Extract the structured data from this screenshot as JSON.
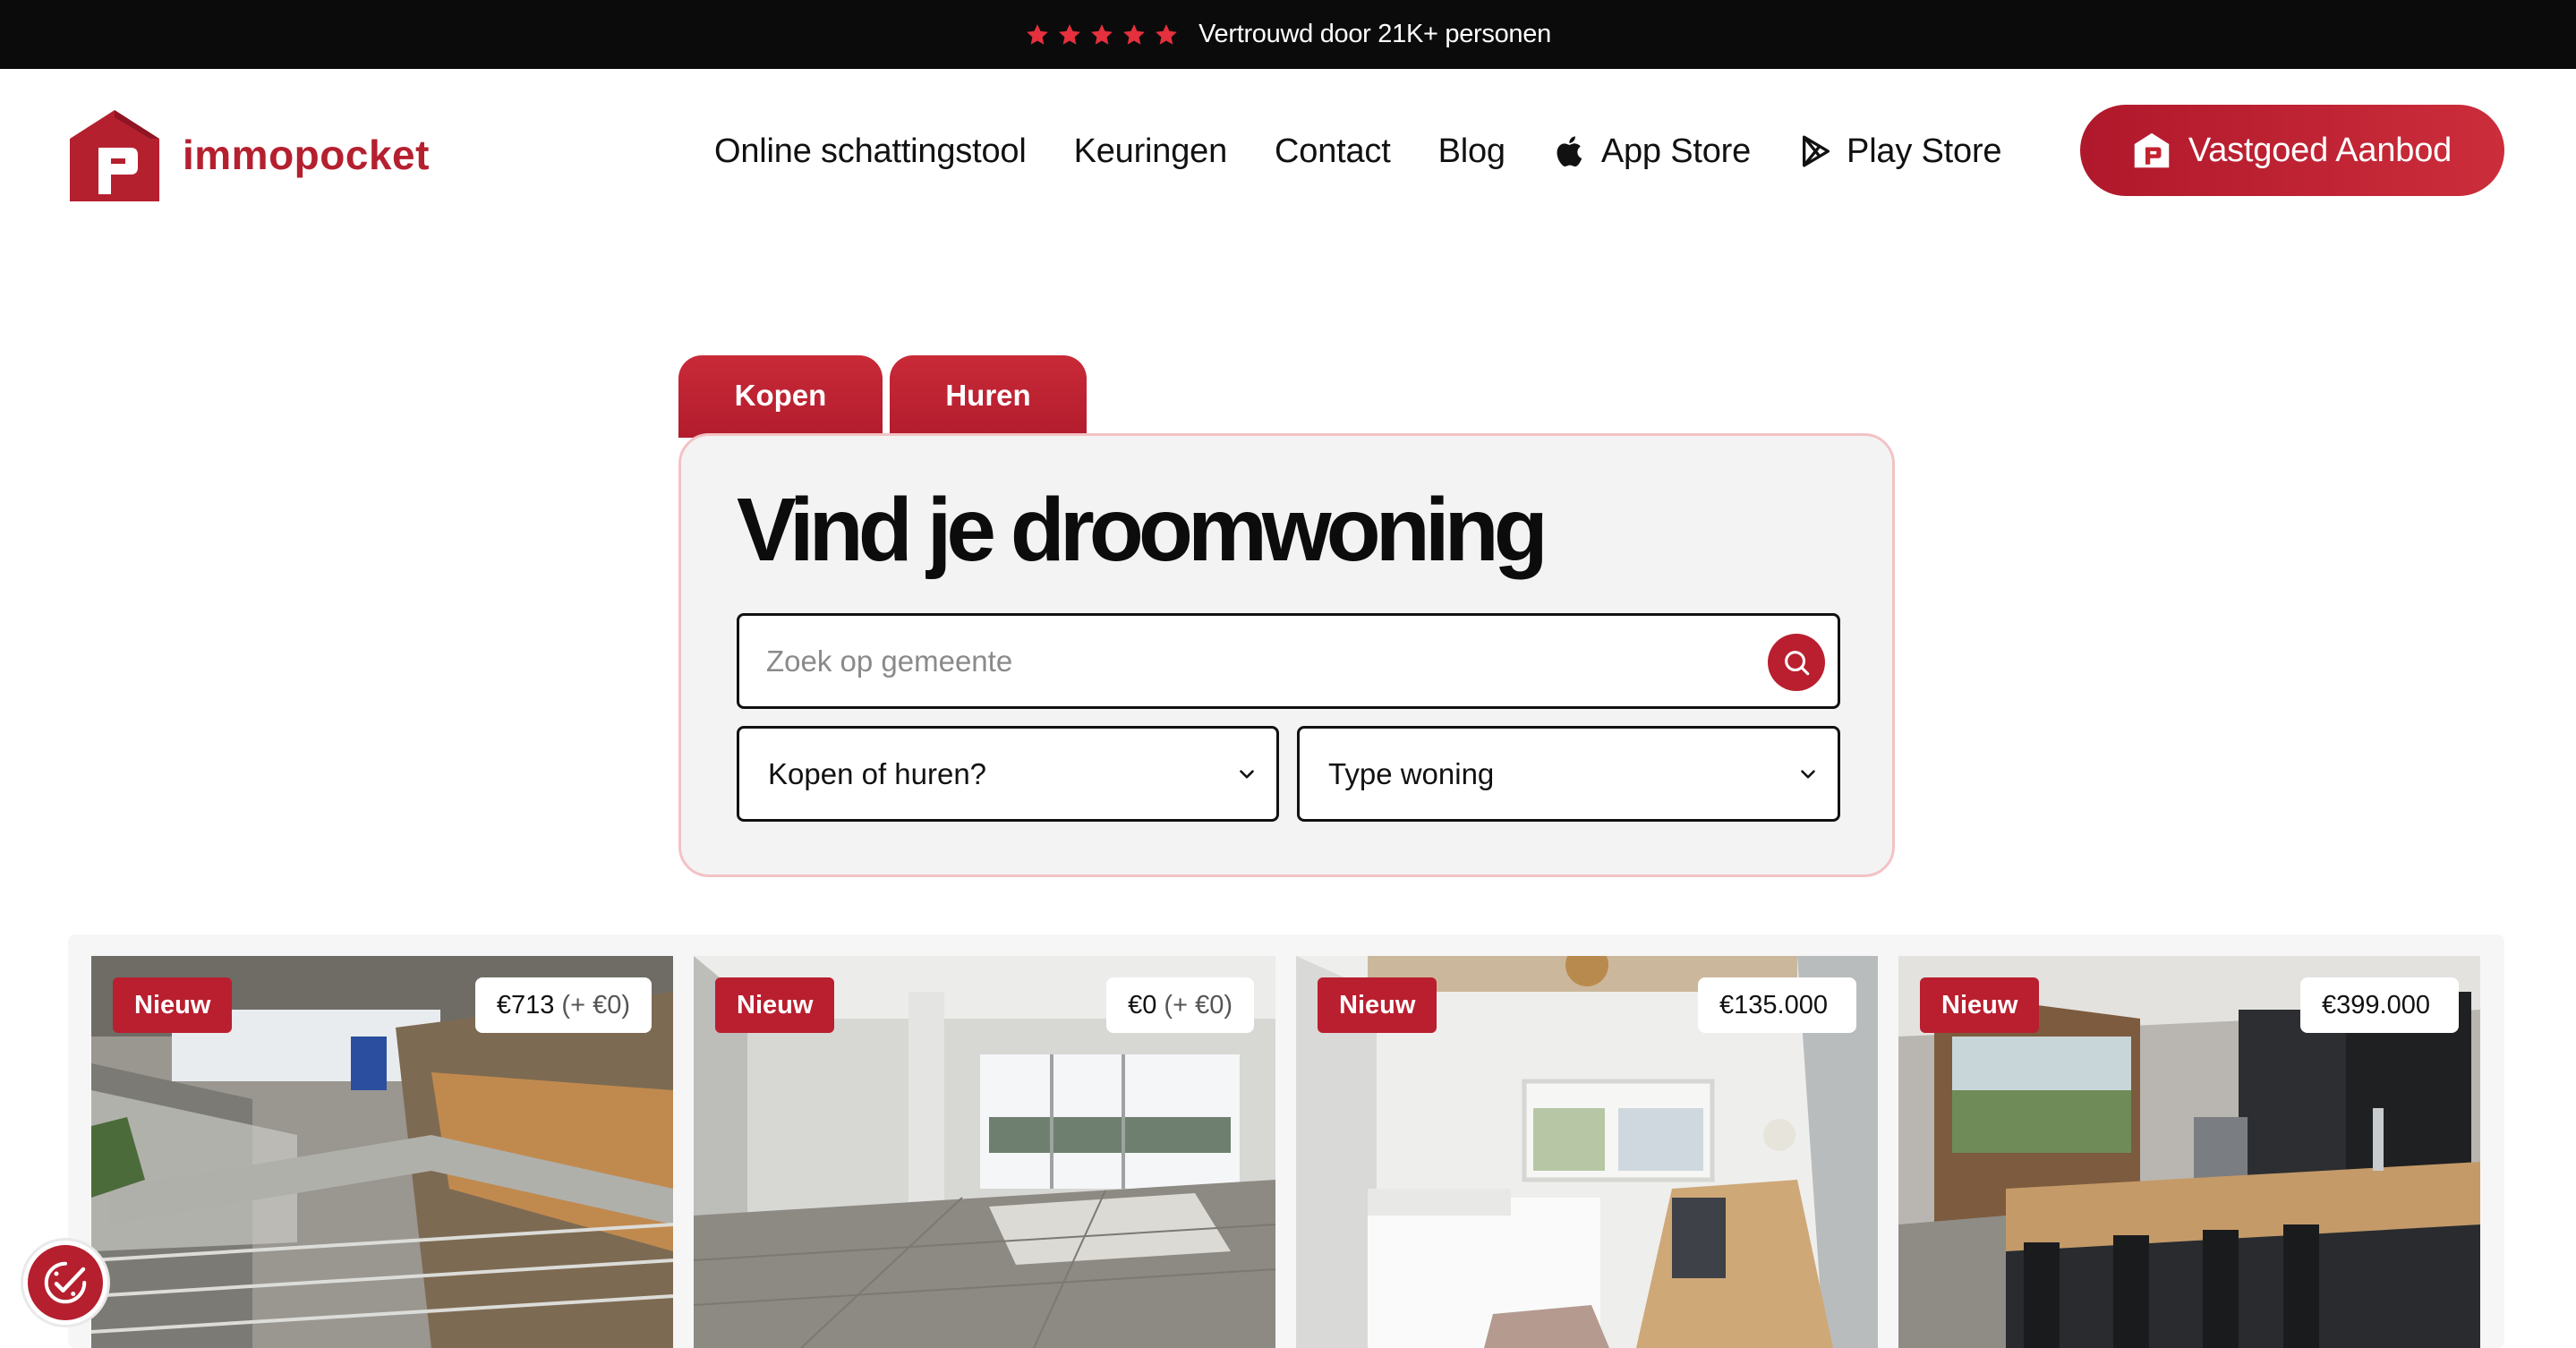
{
  "trust_bar": {
    "rating_stars": 5,
    "text": "Vertrouwd door 21K+ personen",
    "star_color": "#e5303d"
  },
  "header": {
    "logo_text": "immopocket",
    "brand_color": "#b5202f",
    "nav": [
      {
        "label": "Online schattingstool",
        "icon": ""
      },
      {
        "label": "Keuringen",
        "icon": ""
      },
      {
        "label": "Contact",
        "icon": ""
      },
      {
        "label": "Blog",
        "icon": ""
      },
      {
        "label": "App Store",
        "icon": "apple-icon"
      },
      {
        "label": "Play Store",
        "icon": "play-store-icon"
      }
    ],
    "cta_label": "Vastgoed Aanbod"
  },
  "search": {
    "tabs": [
      {
        "label": "Kopen"
      },
      {
        "label": "Huren"
      }
    ],
    "title": "Vind je droomwoning",
    "placeholder": "Zoek op gemeente",
    "select_mode": "Kopen of huren?",
    "select_type": "Type woning"
  },
  "listings": [
    {
      "badge": "Nieuw",
      "price": "€713",
      "price_extra": "(+ €0)"
    },
    {
      "badge": "Nieuw",
      "price": "€0",
      "price_extra": "(+ €0)"
    },
    {
      "badge": "Nieuw",
      "price": "€135.000",
      "price_extra": ""
    },
    {
      "badge": "Nieuw",
      "price": "€399.000",
      "price_extra": ""
    }
  ]
}
